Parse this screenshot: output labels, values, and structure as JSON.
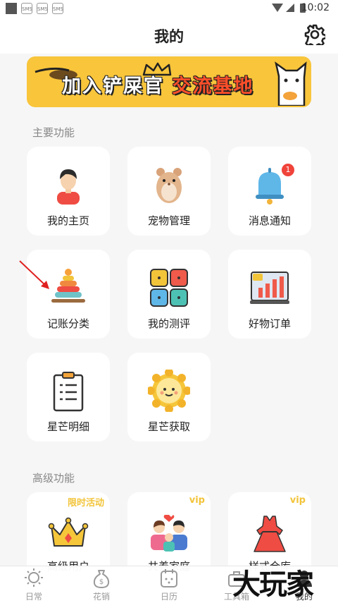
{
  "status_bar": {
    "time": "10:02",
    "apps": [
      "SMS",
      "SMS",
      "SMS"
    ]
  },
  "header": {
    "title": "我的"
  },
  "banner": {
    "text_main": "加入铲屎官",
    "text_highlight": "交流基地"
  },
  "sections": {
    "main": {
      "label": "主要功能",
      "items": [
        {
          "label": "我的主页",
          "icon": "user-icon"
        },
        {
          "label": "宠物管理",
          "icon": "hamster-icon"
        },
        {
          "label": "消息通知",
          "icon": "bell-icon",
          "badge": "1"
        },
        {
          "label": "记账分类",
          "icon": "stacking-rings-icon"
        },
        {
          "label": "我的测评",
          "icon": "grid-icon"
        },
        {
          "label": "好物订单",
          "icon": "chart-board-icon"
        },
        {
          "label": "星芒明细",
          "icon": "clipboard-icon"
        },
        {
          "label": "星芒获取",
          "icon": "sun-icon"
        }
      ]
    },
    "advanced": {
      "label": "高级功能",
      "items": [
        {
          "label": "高级用户",
          "icon": "crown-icon",
          "tag": "限时活动"
        },
        {
          "label": "共养家庭",
          "icon": "family-icon",
          "tag": "vip"
        },
        {
          "label": "样式仓库",
          "icon": "dress-icon",
          "tag": "vip"
        }
      ]
    }
  },
  "bottom_nav": [
    {
      "label": "日常",
      "icon": "sun-outline-icon"
    },
    {
      "label": "花销",
      "icon": "money-bag-icon"
    },
    {
      "label": "日历",
      "icon": "calendar-icon"
    },
    {
      "label": "工具箱",
      "icon": "toolbox-icon"
    },
    {
      "label": "我的",
      "icon": "profile-icon"
    }
  ],
  "watermark": "大玩家"
}
